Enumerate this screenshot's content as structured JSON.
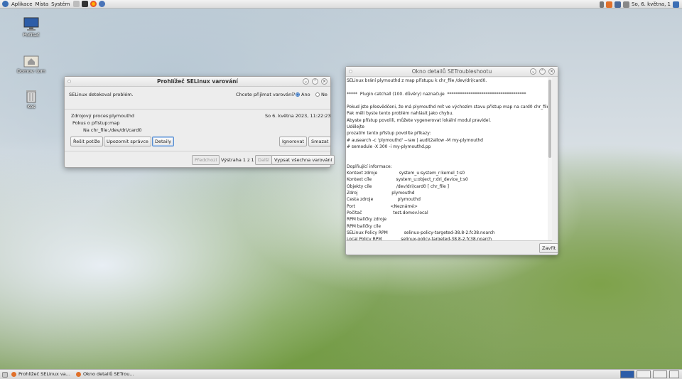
{
  "top_panel": {
    "menus": [
      "Aplikace",
      "Místa",
      "Systém"
    ],
    "clock": "So, 6. května, 1"
  },
  "desktop": {
    "icons": [
      {
        "label": "Počítač",
        "icon": "computer-icon"
      },
      {
        "label": "Domov: tom",
        "icon": "home-folder-icon"
      },
      {
        "label": "Koš",
        "icon": "trash-icon"
      }
    ]
  },
  "alert_window": {
    "title": "Prohlížeč SELinux varování",
    "detected": "SELinux detekoval problém.",
    "receive_question": "Chcete přijímat varování?",
    "radio_yes": "Ano",
    "radio_no": "Ne",
    "source_label": "Zdrojový proces:",
    "source_value": "plymouthd",
    "date": "So 6. května 2023, 11:22:23",
    "attempt_label": "Pokus o přístup:",
    "attempt_value": "map",
    "target_label": "Na chr_file:",
    "target_value": "/dev/dri/card0",
    "buttons": {
      "fix": "Řešit potíže",
      "notify": "Upozornit správce",
      "details": "Detaily",
      "ignore": "Ignorovat",
      "delete": "Smazat",
      "prev": "Předchozí",
      "counter": "Výstraha 1 z 1",
      "next": "Další",
      "list_all": "Vypsat všechna varování"
    }
  },
  "details_window": {
    "title": "Okno detailů SETroubleshootu",
    "lines": [
      "SELinux brání plymouthd z map přístupu k chr_file /dev/dri/card0.",
      "",
      "*****  Plugin catchall (100. důvěry) naznačuje  *************************************",
      "",
      "Pokud jste přesvědčeni, že má plymouthd mít ve výchozím stavu přístup map na card0 chr_file.",
      "Pak měli byste tento problém nahlásit jako chybu.",
      "Abyste přístup povolili, můžete vygenerovat lokální modul pravidel.",
      "Udělejte",
      "prozatím tento přístup povolíte příkazy:",
      "# ausearch -c 'plymouthd' --raw | audit2allow -M my-plymouthd",
      "# semodule -X 300 -i my-plymouthd.pp",
      "",
      "",
      "Doplňující informace:",
      "Kontext zdroje                system_u:system_r:kernel_t:s0",
      "Kontext cíle                  system_u:object_r:dri_device_t:s0",
      "Objekty cíle                  /dev/dri/card0 [ chr_file ]",
      "Zdroj                         plymouthd",
      "Cesta zdroje                  plymouthd",
      "Port                          <Neznámé>",
      "Počítač                       test.domov.local",
      "RPM balíčky zdroje",
      "RPM balíčky cíle",
      "SELinux Policy RPM            selinux-policy-targeted-38.8-2.fc38.noarch",
      "Local Policy RPM              selinux-policy-targeted-38.8-2.fc38.noarch"
    ],
    "close_button": "Zavřít"
  },
  "taskbar": {
    "tasks": [
      "Prohlížeč SELinux va...",
      "Okno detailů SETrou..."
    ]
  },
  "colors": {
    "accent": "#3d78c2",
    "panel": "#e6e6e6",
    "window_bg": "#ededed"
  }
}
